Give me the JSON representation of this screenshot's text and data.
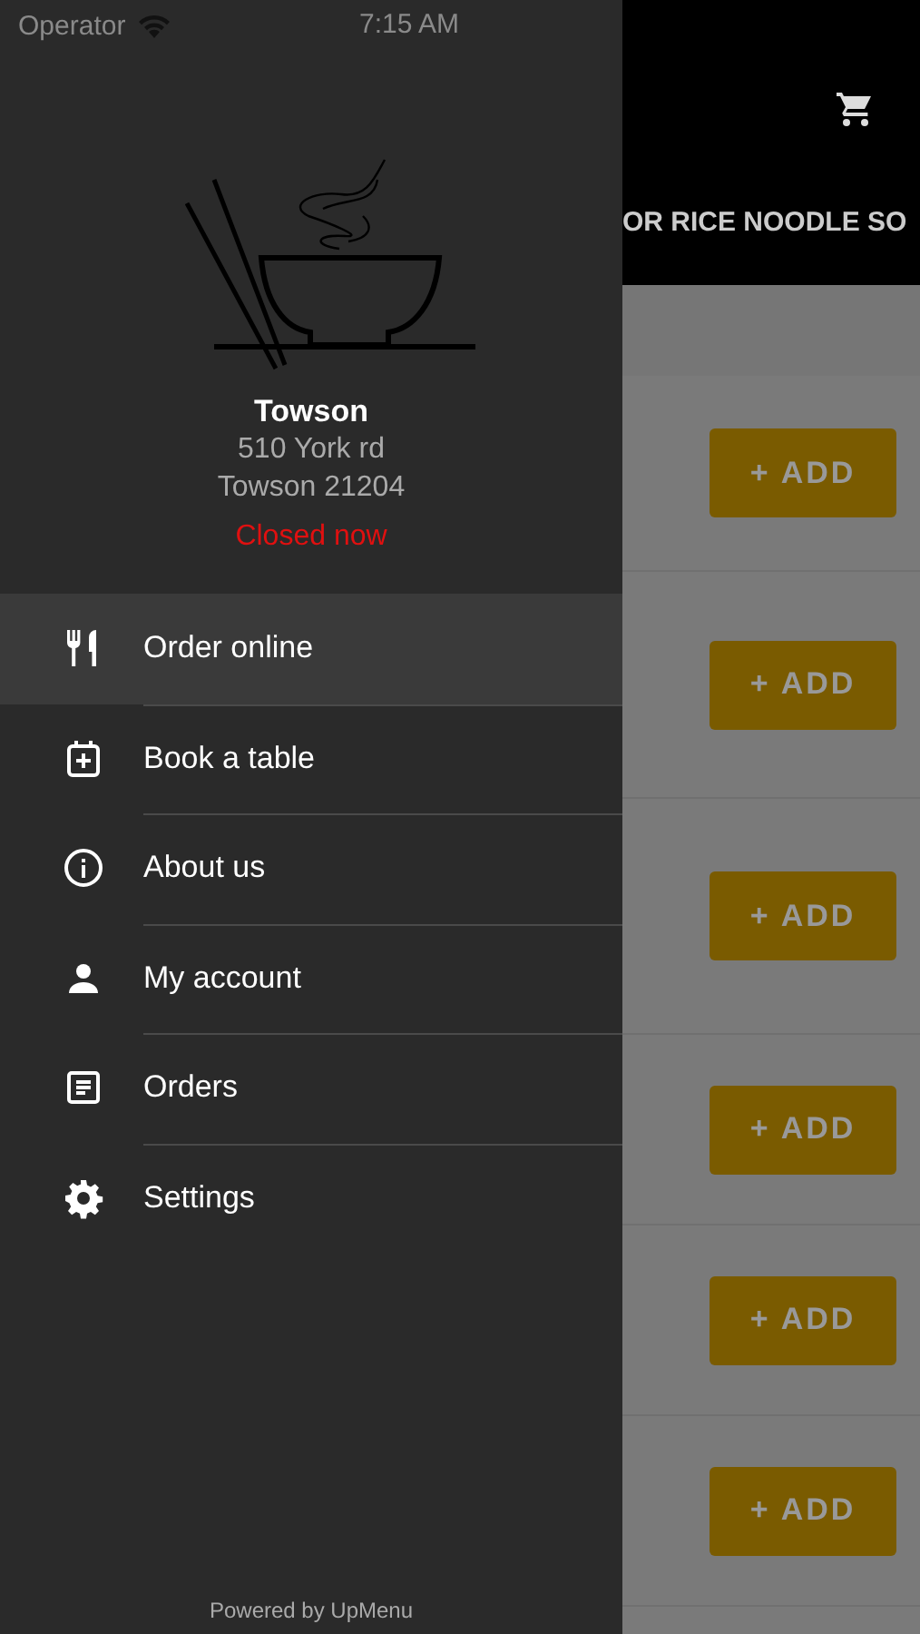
{
  "status_bar": {
    "carrier": "Operator",
    "time": "7:15 AM"
  },
  "drawer": {
    "restaurant_name": "Towson",
    "address_lines": [
      "510 York rd",
      "Towson 21204"
    ],
    "open_status": "Closed now",
    "items": [
      {
        "label": "Order online",
        "selected": true
      },
      {
        "label": "Book a table",
        "selected": false
      },
      {
        "label": "About us",
        "selected": false
      },
      {
        "label": "My account",
        "selected": false
      },
      {
        "label": "Orders",
        "selected": false
      },
      {
        "label": "Settings",
        "selected": false
      }
    ],
    "footer": "Powered by UpMenu"
  },
  "menu": {
    "category_title": "OR RICE NOODLE SO",
    "rows": [
      {
        "button": "+ ADD"
      },
      {
        "button": "+ ADD"
      },
      {
        "button": "+ ADD"
      },
      {
        "button": "+ ADD"
      },
      {
        "button": "+ ADD"
      },
      {
        "button": "+ ADD"
      }
    ]
  }
}
